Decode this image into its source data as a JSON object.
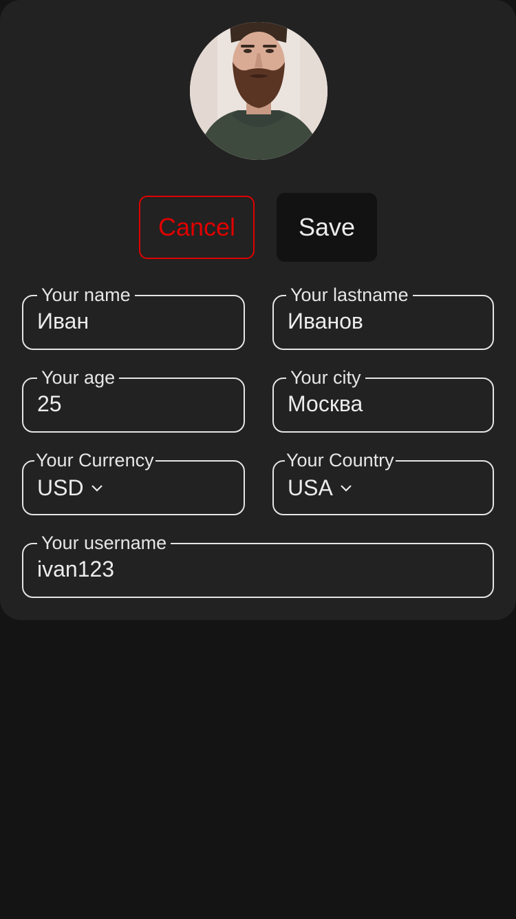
{
  "profile": {
    "avatar_icon": "profile-photo"
  },
  "actions": {
    "cancel_label": "Cancel",
    "save_label": "Save",
    "cancel_color": "#e00000"
  },
  "form": {
    "name": {
      "label": "Your name",
      "value": "Иван"
    },
    "lastname": {
      "label": "Your lastname",
      "value": "Иванов"
    },
    "age": {
      "label": "Your age",
      "value": "25"
    },
    "city": {
      "label": "Your city",
      "value": "Москва"
    },
    "currency": {
      "label": "Your Currency",
      "value": "USD",
      "icon": "chevron-down-icon"
    },
    "country": {
      "label": "Your Country",
      "value": "USA",
      "icon": "chevron-down-icon"
    },
    "username": {
      "label": "Your username",
      "value": "ivan123"
    }
  }
}
